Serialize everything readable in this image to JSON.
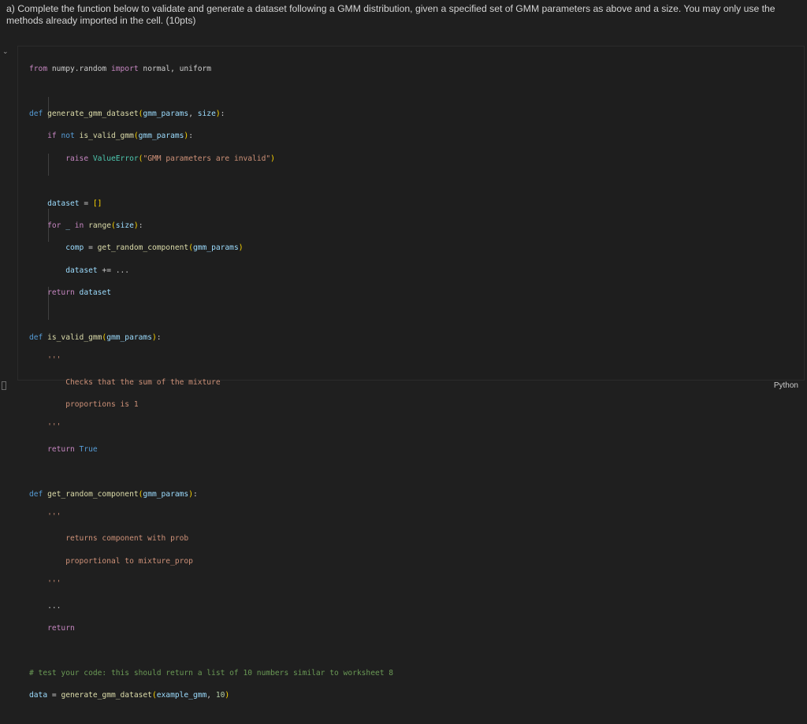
{
  "markdown": {
    "text": "a) Complete the function below to validate and generate a dataset following a GMM distribution, given a specified set of GMM parameters as above and a size. You may only use the methods already imported in the cell. (10pts)"
  },
  "code": {
    "l1": {
      "kw_from": "from",
      "mod": "numpy.random",
      "kw_import": "import",
      "names": "normal, uniform"
    },
    "l3": {
      "kw": "def",
      "name": "generate_gmm_dataset",
      "p1": "gmm_params",
      "sep": ", ",
      "p2": "size"
    },
    "l4": {
      "kw_if": "if",
      "kw_not": "not",
      "call": "is_valid_gmm",
      "arg": "gmm_params"
    },
    "l5": {
      "kw": "raise",
      "cls": "ValueError",
      "str": "\"GMM parameters are invalid\""
    },
    "l7": {
      "var": "dataset",
      "op": " = ",
      "val": "[]"
    },
    "l8": {
      "kw_for": "for",
      "var": "_",
      "kw_in": "in",
      "fn": "range",
      "arg": "size"
    },
    "l9": {
      "var": "comp",
      "op": " = ",
      "fn": "get_random_component",
      "arg": "gmm_params"
    },
    "l10": {
      "var": "dataset",
      "op": " += ..."
    },
    "l11": {
      "kw": "return",
      "var": "dataset"
    },
    "l13": {
      "kw": "def",
      "name": "is_valid_gmm",
      "p1": "gmm_params"
    },
    "l14": {
      "doc": "'''"
    },
    "l15": {
      "doc": "Checks that the sum of the mixture"
    },
    "l16": {
      "doc": "proportions is 1"
    },
    "l17": {
      "doc": "'''"
    },
    "l18": {
      "kw": "return",
      "val": "True"
    },
    "l20": {
      "kw": "def",
      "name": "get_random_component",
      "p1": "gmm_params"
    },
    "l21": {
      "doc": "'''"
    },
    "l22": {
      "doc": "returns component with prob"
    },
    "l23": {
      "doc": "proportional to mixture_prop"
    },
    "l24": {
      "doc": "'''"
    },
    "l25": {
      "text": "..."
    },
    "l26": {
      "kw": "return"
    },
    "l28": {
      "comment": "# test your code: this should return a list of 10 numbers similar to worksheet 8"
    },
    "l29": {
      "var": "data",
      "op": " = ",
      "fn": "generate_gmm_dataset",
      "arg1": "example_gmm",
      "sep": ", ",
      "num": "10"
    }
  },
  "language": "Python",
  "colors": {
    "background": "#1f1f1f",
    "keyword": "#569cd6",
    "control": "#c586c0",
    "function": "#dcdcaa",
    "string": "#ce9178",
    "class": "#4ec9b0",
    "comment": "#6a9955",
    "number": "#b5cea8"
  }
}
